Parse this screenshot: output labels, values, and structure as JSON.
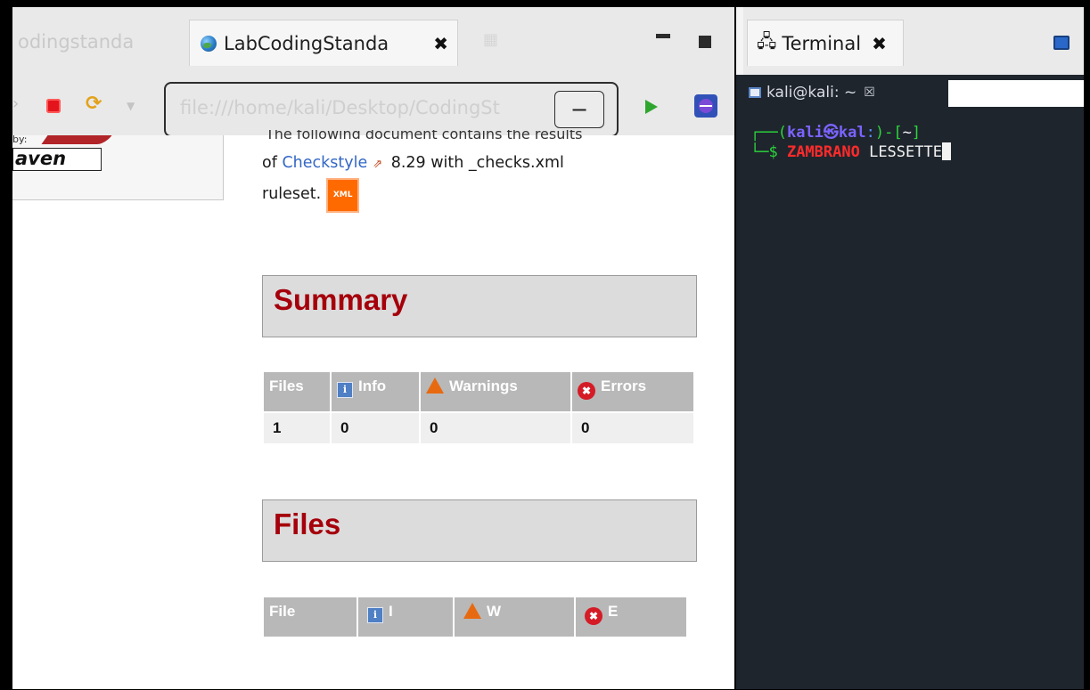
{
  "browser": {
    "inactive_tab_label": "odingstanda",
    "active_tab_label": "LabCodingStanda",
    "close_glyph": "✖",
    "url": "file:///home/kali/Desktop/CodingSt",
    "url_minus": "−"
  },
  "page": {
    "maven_by": "by:",
    "maven_logo": "aven",
    "intro_cut": "The following document contains the results",
    "intro_prefix": "of ",
    "checkstyle_link": "Checkstyle",
    "intro_suffix": " 8.29 with _checks.xml",
    "intro_line2": "ruleset.",
    "xml_badge": "XML",
    "summary_title": "Summary",
    "summary_table": {
      "headers": [
        "Files",
        "Info",
        "Warnings",
        "Errors"
      ],
      "row": [
        "1",
        "0",
        "0",
        "0"
      ]
    },
    "files_title": "Files",
    "files_table": {
      "headers": [
        "File",
        "I",
        "W",
        "E"
      ]
    }
  },
  "terminal": {
    "view_tab_label": "Terminal",
    "session_tab_label": "kali@kali: ~",
    "session_close": "☒",
    "prompt_line1_prefix": "┌──(",
    "prompt_user": "kali㉿kal",
    "prompt_line1_mid": ":",
    "prompt_line1_close": ")-[",
    "prompt_dir": "~",
    "prompt_line1_end": "]",
    "prompt_line2_prefix": "└─$ ",
    "command": "ZAMBRANO",
    "argument": " LESSETTE"
  },
  "icons": {
    "globe": "globe-icon",
    "stop": "stop-icon",
    "refresh": "refresh-icon",
    "go": "play-icon",
    "terminal": "terminal-icon"
  },
  "colors": {
    "section_title": "#a5000b",
    "table_header": "#b8b8b8",
    "terminal_bg": "#1f252d",
    "prompt_green": "#2bd63c",
    "command_red": "#ff2b2b"
  }
}
